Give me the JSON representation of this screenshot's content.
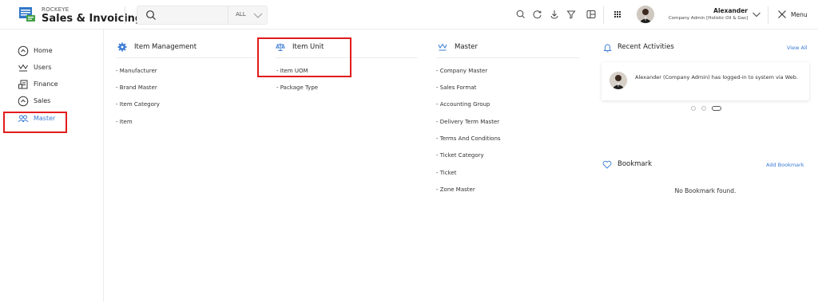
{
  "header": {
    "brand_top": "ROCKEYE",
    "brand_name": "Sales & Invoicing",
    "search": {
      "scope": "ALL"
    },
    "tools": [
      "search-icon",
      "refresh-icon",
      "download-icon",
      "filter-icon",
      "layout-icon",
      "apps-grid-icon"
    ],
    "user": {
      "name": "Alexander",
      "role": "Company Admin [Holistic Oil & Gas]"
    },
    "menu_label": "Menu"
  },
  "sidebar": {
    "items": [
      {
        "label": "Home",
        "icon": "home-icon",
        "active": false
      },
      {
        "label": "Users",
        "icon": "users-crown-icon",
        "active": false
      },
      {
        "label": "Finance",
        "icon": "finance-icon",
        "active": false
      },
      {
        "label": "Sales",
        "icon": "sales-icon",
        "active": false
      },
      {
        "label": "Master",
        "icon": "master-people-icon",
        "active": true
      }
    ]
  },
  "columns": [
    {
      "title": "Item Management",
      "icon": "gear-icon",
      "links": [
        "- Manufacturer",
        "- Brand Master",
        "- Item Category",
        "- Item"
      ]
    },
    {
      "title": "Item Unit",
      "icon": "scale-icon",
      "links": [
        "- Item UOM",
        "- Package Type"
      ]
    },
    {
      "title": "Master",
      "icon": "crown-icon",
      "links": [
        "- Company Master",
        "- Sales Format",
        "- Accounting Group",
        "- Delivery Term Master",
        "- Terms And Conditions",
        "- Ticket Category",
        "- Ticket",
        "- Zone Master"
      ]
    }
  ],
  "recent": {
    "title": "Recent Activities",
    "action": "View All",
    "activity_text": "Alexander (Company Admin) has logged-in to system via Web."
  },
  "bookmark": {
    "title": "Bookmark",
    "action": "Add Bookmark",
    "empty": "No Bookmark found."
  },
  "colors": {
    "accent": "#3a7bd5",
    "highlight": "#e21b1b"
  }
}
